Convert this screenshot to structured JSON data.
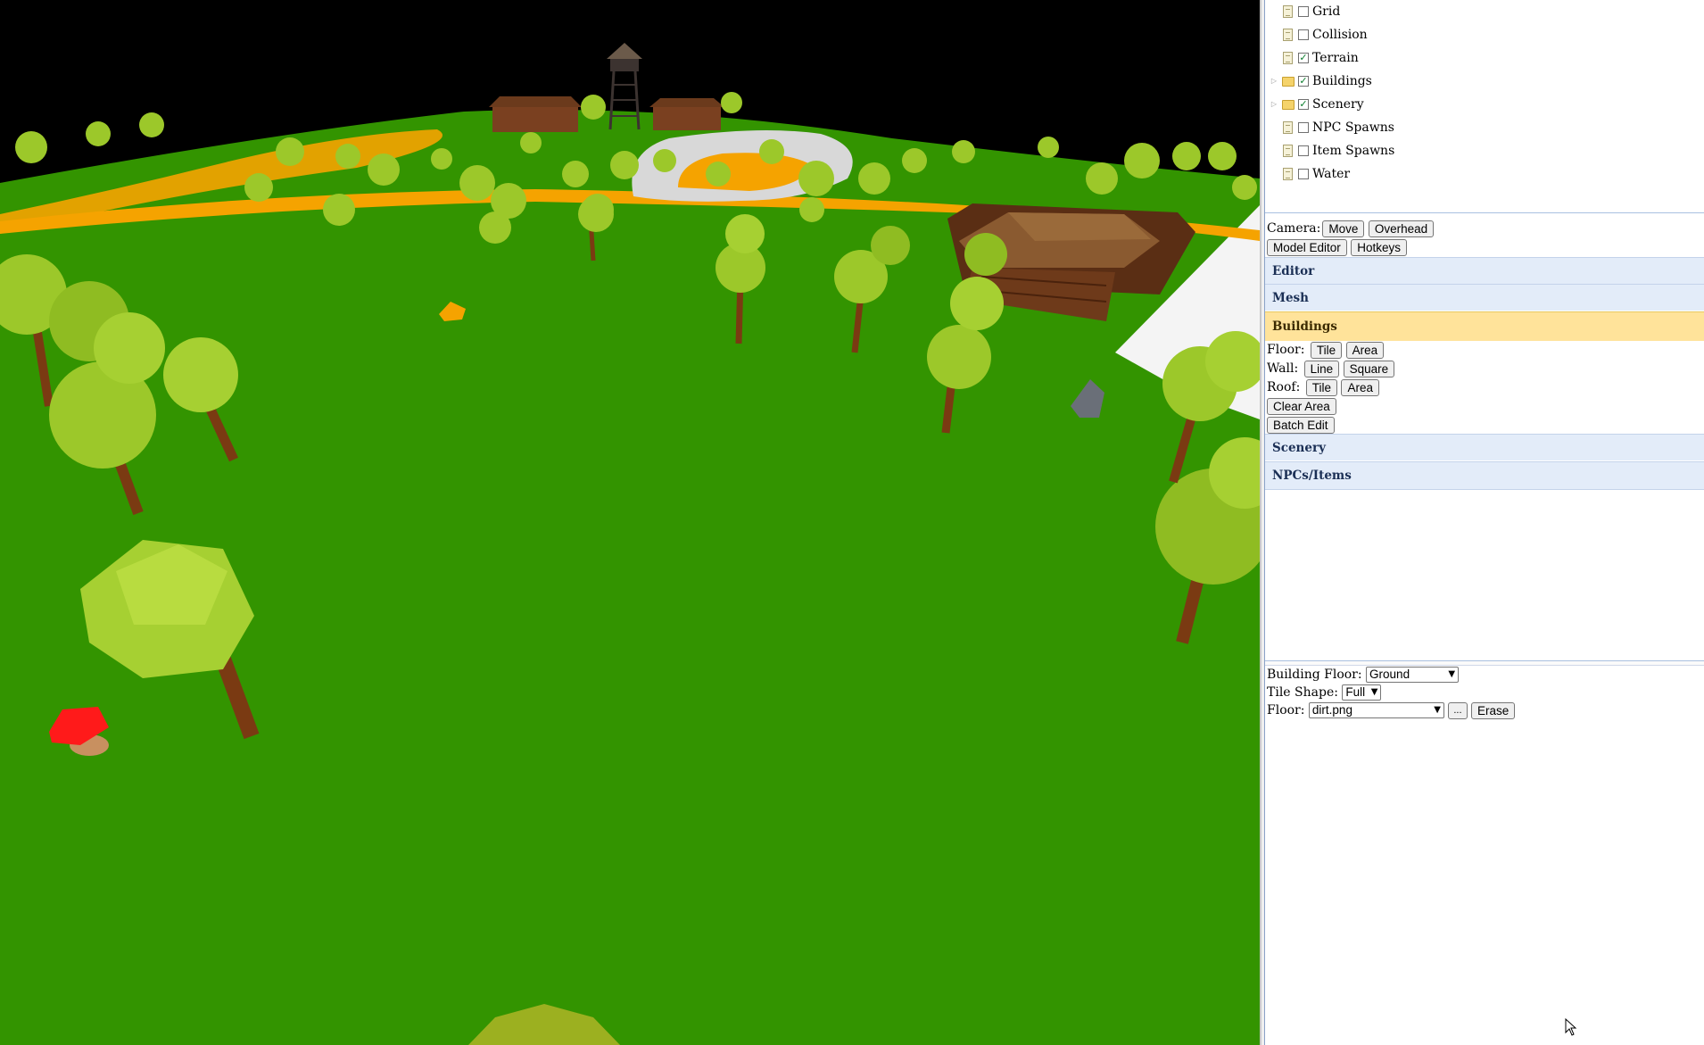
{
  "layers": [
    {
      "label": "Grid",
      "type": "doc",
      "checked": false,
      "expandable": false
    },
    {
      "label": "Collision",
      "type": "doc",
      "checked": false,
      "expandable": false
    },
    {
      "label": "Terrain",
      "type": "doc",
      "checked": true,
      "expandable": false
    },
    {
      "label": "Buildings",
      "type": "folder",
      "checked": true,
      "expandable": true
    },
    {
      "label": "Scenery",
      "type": "folder",
      "checked": true,
      "expandable": true
    },
    {
      "label": "NPC Spawns",
      "type": "doc",
      "checked": false,
      "expandable": false
    },
    {
      "label": "Item Spawns",
      "type": "doc",
      "checked": false,
      "expandable": false
    },
    {
      "label": "Water",
      "type": "doc",
      "checked": false,
      "expandable": false
    }
  ],
  "camera": {
    "label": "Camera:",
    "move": "Move",
    "overhead": "Overhead",
    "model_editor": "Model Editor",
    "hotkeys": "Hotkeys"
  },
  "sections": {
    "editor": "Editor",
    "mesh": "Mesh",
    "buildings": "Buildings",
    "scenery": "Scenery",
    "npcs_items": "NPCs/Items"
  },
  "buildings": {
    "floor_label": "Floor:",
    "floor_tile": "Tile",
    "floor_area": "Area",
    "wall_label": "Wall:",
    "wall_line": "Line",
    "wall_square": "Square",
    "roof_label": "Roof:",
    "roof_tile": "Tile",
    "roof_area": "Area",
    "clear_area": "Clear Area",
    "batch_edit": "Batch Edit"
  },
  "props": {
    "building_floor_label": "Building Floor:",
    "building_floor_value": "Ground",
    "tile_shape_label": "Tile Shape:",
    "tile_shape_value": "Full",
    "floor_label": "Floor:",
    "floor_value": "dirt.png",
    "browse": "...",
    "erase": "Erase"
  },
  "colors": {
    "grass": "#339400",
    "sky": "#000000",
    "path": "#f5a300",
    "tree_leaves": "#9cc82a",
    "trunk": "#7a3a12",
    "active_section": "#ffe39a",
    "section": "#e3ecf9"
  }
}
